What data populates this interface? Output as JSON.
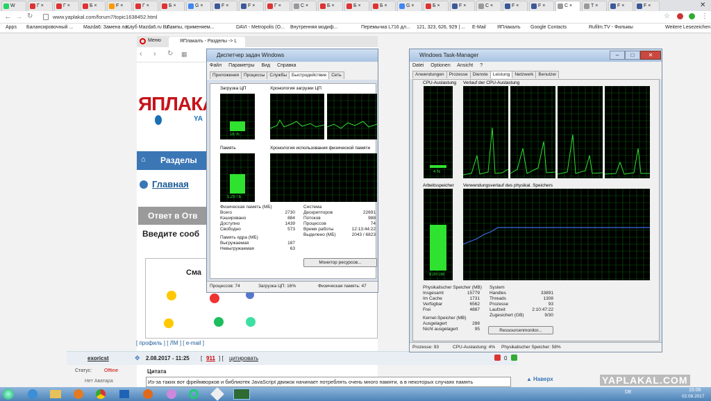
{
  "browser": {
    "tabs": [
      {
        "label": "W",
        "active": false
      },
      {
        "label": "Г ×",
        "active": false
      },
      {
        "label": "Г ×",
        "active": false
      },
      {
        "label": "Б ×",
        "active": false
      },
      {
        "label": "F ×",
        "active": false
      },
      {
        "label": "Г ×",
        "active": false
      },
      {
        "label": "Б ×",
        "active": false
      },
      {
        "label": "G ×",
        "active": false
      },
      {
        "label": "F ×",
        "active": false
      },
      {
        "label": "F ×",
        "active": false
      },
      {
        "label": "Г ×",
        "active": false
      },
      {
        "label": "С ×",
        "active": false
      },
      {
        "label": "Б ×",
        "active": false
      },
      {
        "label": "Б ×",
        "active": false
      },
      {
        "label": "Б ×",
        "active": false
      },
      {
        "label": "G ×",
        "active": false
      },
      {
        "label": "Б ×",
        "active": false
      },
      {
        "label": "F ×",
        "active": false
      },
      {
        "label": "С ×",
        "active": false
      },
      {
        "label": "F ×",
        "active": false
      },
      {
        "label": "F ×",
        "active": false
      },
      {
        "label": "С ×",
        "active": true
      },
      {
        "label": "Т ×",
        "active": false
      },
      {
        "label": "F ×",
        "active": false
      },
      {
        "label": "F ×",
        "active": false
      }
    ],
    "url": "www.yaplakal.com/forum7/topic1638452.html",
    "bookmarks": [
      "Apps",
      "Балансировочный ...",
      "Mazda6: Замена ла...",
      "Клуб Mazda6.ru Вх...",
      "Лампы, применяем...",
      "DAVI - Metropolis (О...",
      "Внутренняя модиф...",
      "Перемычка L716 дл...",
      "121, 323, 626, 929 | ...",
      "E-Mail",
      "ЯПлакалъ",
      "Google Contacts",
      "Rufilm.TV - Фильмы",
      "Weitere Lesezeichen"
    ]
  },
  "inner_browser": {
    "menu_label": "Меню",
    "tab_label": "ЯПлакалъ - Разделы -> L",
    "logo": "ЯПЛАКАЛ",
    "logo_sub": "YA",
    "sections": "Разделы",
    "breadcrumb": "Главная",
    "reply_header": "Ответ в Отв",
    "enter_text": "Введите сооб",
    "smiles": "Сма",
    "links": "[ профиль ] [ ЛМ ] [ e-mail ]",
    "post_author": "exoricst",
    "post_date": "2.08.2017 - 11:25",
    "post_num": "911",
    "post_cite": "цитировать",
    "status_label": "Статус:",
    "status_value": "Offline",
    "no_avatar": "Нет Аватара",
    "quote_title": "Цитата",
    "quote_text": "Из-за таких вот фреймворков и библиотек JavaScript движок начинает потреблять очень много памяти, а в некоторых случаях память",
    "up": "Наверх",
    "rating": "0",
    "watermark": "YAPLAKAL.COM"
  },
  "tm_ru": {
    "title": "Диспетчер задач Windows",
    "menu": [
      "Файл",
      "Параметры",
      "Вид",
      "Справка"
    ],
    "tabs": [
      "Приложения",
      "Процессы",
      "Службы",
      "Быстродействие",
      "Сеть"
    ],
    "active_tab": 3,
    "cpu_label": "Загрузка ЦП",
    "cpu_value": "16 %",
    "cpu_hist_label": "Хронология загрузки ЦП",
    "mem_label": "Память",
    "mem_value": "1,25 ГБ",
    "mem_hist_label": "Хронология использования физической памяти",
    "phys_title": "Физическая память (МБ)",
    "phys": [
      [
        "Всего",
        "2730"
      ],
      [
        "Кэшировано",
        "884"
      ],
      [
        "Доступно",
        "1439"
      ],
      [
        "Свободно",
        "573"
      ]
    ],
    "sys_title": "Система",
    "sys": [
      [
        "Дескрипторов",
        "22691"
      ],
      [
        "Потоков",
        "988"
      ],
      [
        "Процессов",
        "74"
      ],
      [
        "Время работы",
        "12:13:44:22"
      ],
      [
        "Выделено (МБ)",
        "2043 / 6823"
      ]
    ],
    "kernel_title": "Память ядра (МБ)",
    "kernel": [
      [
        "Выгружаемая",
        "187"
      ],
      [
        "Невыгружаемая",
        "63"
      ]
    ],
    "monitor_btn": "Монитор ресурсов...",
    "status": [
      "Процессов: 74",
      "Загрузка ЦП: 16%",
      "Физическая память: 47"
    ]
  },
  "tm_de": {
    "title": "Windows Task-Manager",
    "menu": [
      "Datei",
      "Optionen",
      "Ansicht",
      "?"
    ],
    "tabs": [
      "Anwendungen",
      "Prozesse",
      "Dienste",
      "Leistung",
      "Netzwerk",
      "Benutzer"
    ],
    "active_tab": 3,
    "cpu_label": "CPU-Auslastung",
    "cpu_value": "4 %",
    "cpu_hist_label": "Verlauf der CPU-Auslastung",
    "mem_label": "Arbeitsspeicher",
    "mem_value": "9,00 GB",
    "mem_hist_label": "Verwendungsverlauf des physikal. Speichers",
    "phys_title": "Physikalischer Speicher (MB)",
    "phys": [
      [
        "Insgesamt",
        "15779"
      ],
      [
        "Im Cache",
        "1731"
      ],
      [
        "Verfügbar",
        "6562"
      ],
      [
        "Frei",
        "4887"
      ]
    ],
    "sys_title": "System",
    "sys": [
      [
        "Handles",
        "33891"
      ],
      [
        "Threads",
        "1308"
      ],
      [
        "Prozesse",
        "93"
      ],
      [
        "Laufzeit",
        "2:10:47:22"
      ],
      [
        "Zugesichert (GB)",
        "9/30"
      ]
    ],
    "kernel_title": "Kernel-Speicher (MB)",
    "kernel": [
      [
        "Ausgelagert",
        "288"
      ],
      [
        "Nicht ausgelagert",
        "95"
      ]
    ],
    "monitor_btn": "Ressourcenmonitor...",
    "status": [
      "Prozesse: 93",
      "CPU-Auslastung: 4%",
      "Physikalischer Speicher: 58%"
    ]
  },
  "taskbar": {
    "lang": "DE",
    "time": "15:06",
    "date": "02.08.2017"
  }
}
